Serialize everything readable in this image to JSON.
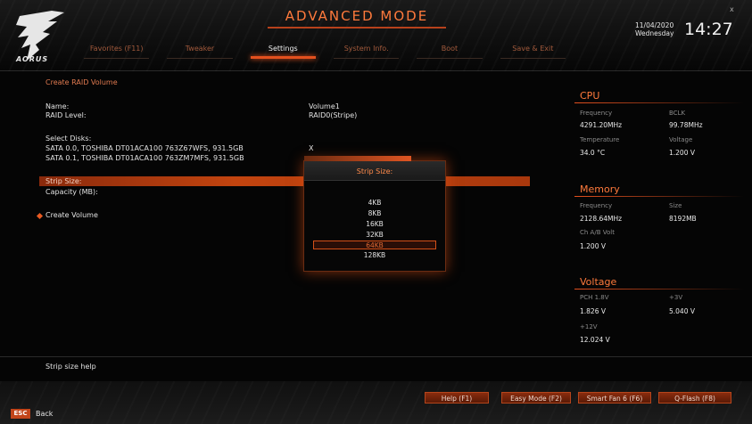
{
  "header": {
    "logo_text": "AORUS",
    "mode": "ADVANCED MODE",
    "tabs": [
      {
        "label": "Favorites (F11)",
        "active": false
      },
      {
        "label": "Tweaker",
        "active": false
      },
      {
        "label": "Settings",
        "active": true
      },
      {
        "label": "System Info.",
        "active": false
      },
      {
        "label": "Boot",
        "active": false
      },
      {
        "label": "Save & Exit",
        "active": false
      }
    ],
    "date": "11/04/2020",
    "day": "Wednesday",
    "time": "14:27",
    "close": "x"
  },
  "main": {
    "breadcrumb": "Create RAID Volume",
    "name_label": "Name:",
    "name_value": "Volume1",
    "raid_label": "RAID Level:",
    "raid_value": "RAID0(Stripe)",
    "select_disks_label": "Select Disks:",
    "disks": [
      {
        "label": "SATA 0.0, TOSHIBA DT01ACA100 763Z67WFS, 931.5GB",
        "value": "X"
      },
      {
        "label": "SATA 0.1, TOSHIBA DT01ACA100 763ZM7MFS, 931.5GB",
        "value": ""
      }
    ],
    "strip_label": "Strip Size:",
    "capacity_label": "Capacity (MB):",
    "create_label": "Create Volume"
  },
  "popup": {
    "title": "Strip Size:",
    "options": [
      "4KB",
      "8KB",
      "16KB",
      "32KB",
      "64KB",
      "128KB"
    ],
    "selected": "64KB"
  },
  "panel": {
    "cpu": {
      "title": "CPU",
      "freq_label": "Frequency",
      "freq_value": "4291.20MHz",
      "bclk_label": "BCLK",
      "bclk_value": "99.78MHz",
      "temp_label": "Temperature",
      "temp_value": "34.0 °C",
      "volt_label": "Voltage",
      "volt_value": "1.200 V"
    },
    "memory": {
      "title": "Memory",
      "freq_label": "Frequency",
      "freq_value": "2128.64MHz",
      "size_label": "Size",
      "size_value": "8192MB",
      "chab_label": "Ch A/B Volt",
      "chab_value": "1.200 V"
    },
    "voltage": {
      "title": "Voltage",
      "pch_label": "PCH 1.8V",
      "pch_value": "1.826 V",
      "p3_label": "+3V",
      "p3_value": "5.040 V",
      "p12_label": "+12V",
      "p12_value": "12.024 V"
    }
  },
  "help_text": "Strip size help",
  "footer": {
    "buttons": [
      "Help (F1)",
      "Easy Mode (F2)",
      "Smart Fan 6 (F6)",
      "Q-Flash (F8)"
    ],
    "esc_key": "ESC",
    "back_label": "Back"
  },
  "colors": {
    "accent": "#e3501e",
    "highlight": "#c2440f",
    "text": "#e2e2e2"
  }
}
